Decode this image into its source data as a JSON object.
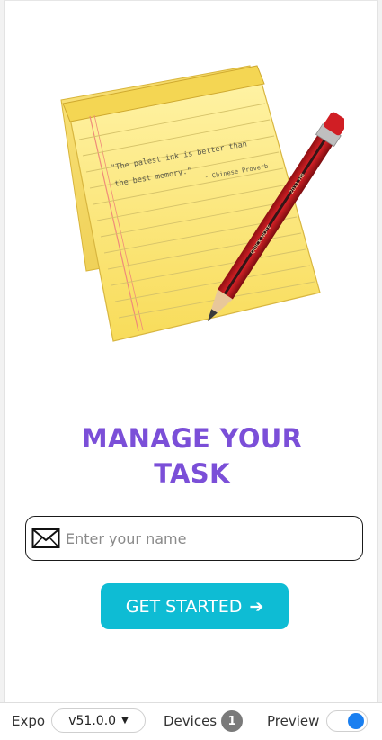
{
  "screen": {
    "title_line1": "MANAGE YOUR",
    "title_line2": "TASK",
    "name_input": {
      "placeholder": "Enter your name",
      "value": ""
    },
    "cta_label": "GET STARTED",
    "cta_arrow": "➔",
    "hero_note_text": {
      "quote_line1": "\"The palest ink is better than",
      "quote_line2": "the best memory.\"",
      "attribution": "- Chinese Proverb"
    },
    "pencil_text": {
      "brand": "QUICK NOTE",
      "grade": "2011 HB"
    }
  },
  "bottom_bar": {
    "expo_label": "Expo",
    "version_label": "v51.0.0",
    "devices_label": "Devices",
    "devices_count": "1",
    "preview_label": "Preview",
    "preview_enabled": true
  },
  "colors": {
    "title": "#7b4fd8",
    "cta": "#0ebcd4",
    "toggle_on": "#1a7ff0"
  }
}
